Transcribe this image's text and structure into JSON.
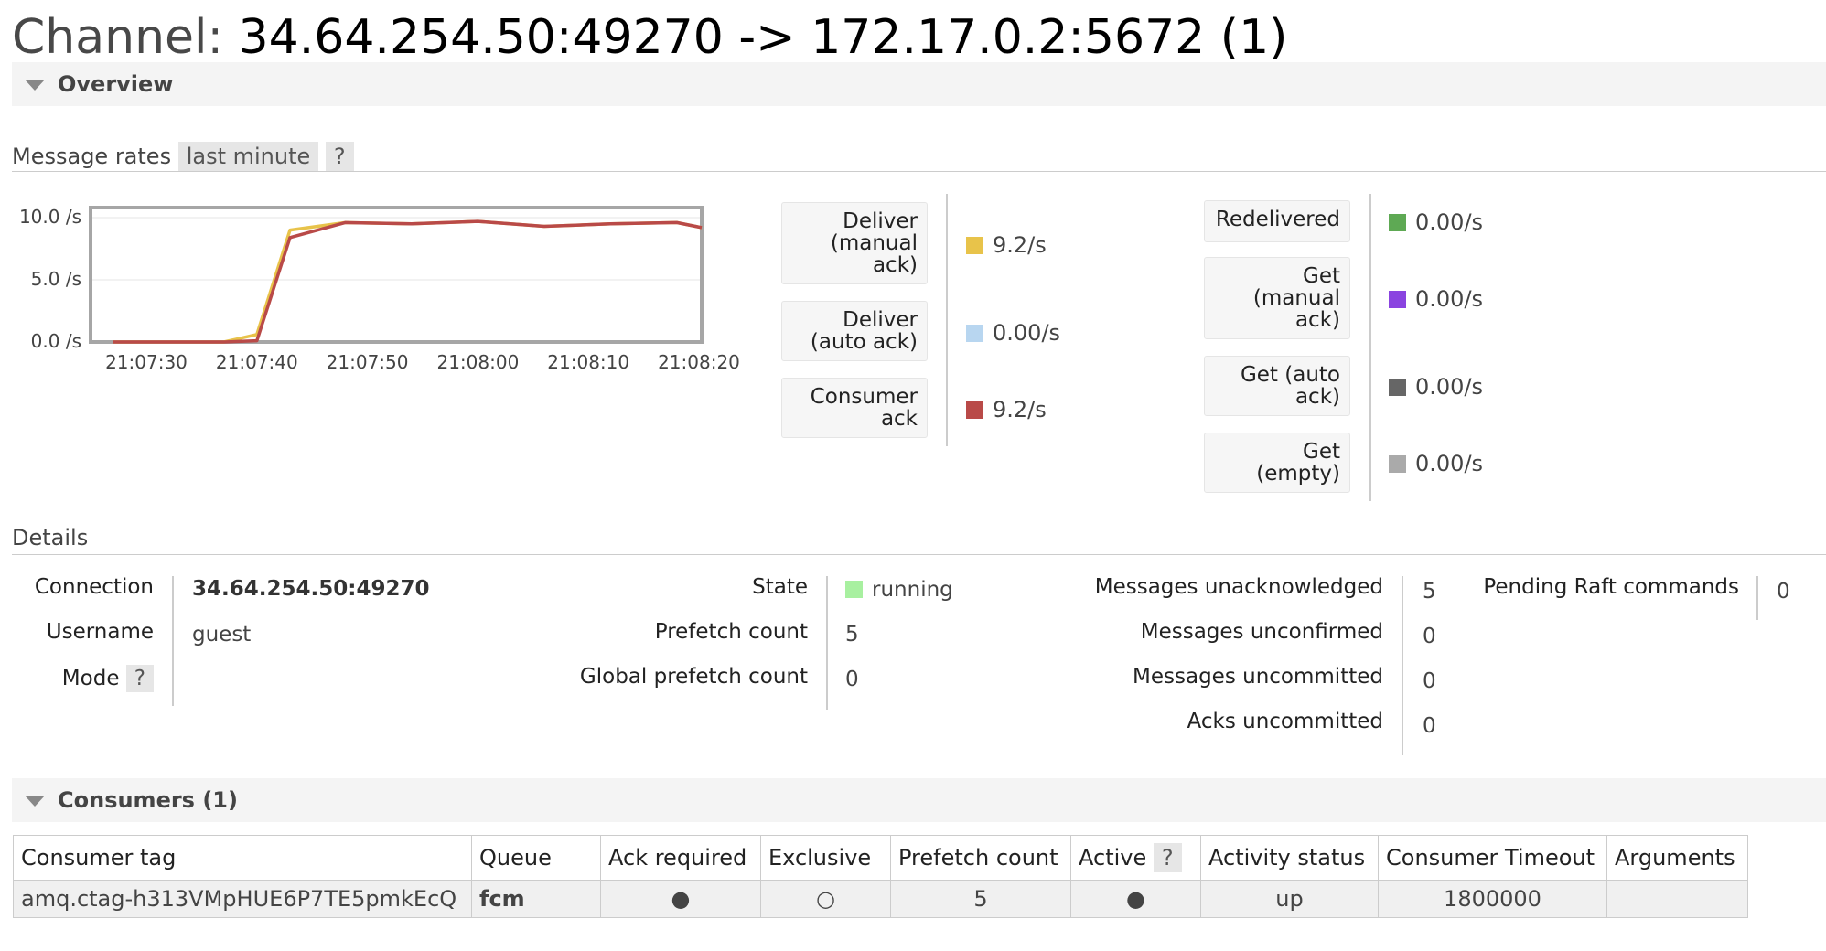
{
  "title": {
    "label": "Channel:",
    "value": "34.64.254.50:49270 -> 172.17.0.2:5672 (1)"
  },
  "overview": {
    "label": "Overview"
  },
  "message_rates": {
    "label": "Message rates",
    "range": "last minute",
    "help": "?"
  },
  "chart_data": {
    "type": "line",
    "x": [
      "21:07:27",
      "21:07:32",
      "21:07:37",
      "21:07:40",
      "21:07:43",
      "21:07:48",
      "21:07:54",
      "21:08:00",
      "21:08:06",
      "21:08:12",
      "21:08:18",
      "21:08:22"
    ],
    "x_ticks": [
      "21:07:30",
      "21:07:40",
      "21:07:50",
      "21:08:00",
      "21:08:10",
      "21:08:20"
    ],
    "y_ticks": [
      "10.0 /s",
      "5.0 /s",
      "0.0 /s"
    ],
    "ylim": [
      0,
      10
    ],
    "series": [
      {
        "name": "Deliver (manual ack)",
        "color": "#e8c34a",
        "values": [
          0,
          0,
          0,
          0.6,
          9.0,
          9.6,
          9.5,
          9.7,
          9.3,
          9.5,
          9.6,
          9.2
        ]
      },
      {
        "name": "Consumer ack",
        "color": "#b94a48",
        "values": [
          0,
          0,
          0,
          0.1,
          8.4,
          9.6,
          9.5,
          9.7,
          9.3,
          9.5,
          9.6,
          9.2
        ]
      }
    ]
  },
  "legend_left": [
    {
      "label": "Deliver (manual ack)",
      "value": "9.2/s",
      "color": "#e8c34a"
    },
    {
      "label": "Deliver (auto ack)",
      "value": "0.00/s",
      "color": "#b8d6f0"
    },
    {
      "label": "Consumer ack",
      "value": "9.2/s",
      "color": "#b94a48"
    }
  ],
  "legend_right": [
    {
      "label": "Redelivered",
      "value": "0.00/s",
      "color": "#5ea954"
    },
    {
      "label": "Get (manual ack)",
      "value": "0.00/s",
      "color": "#8a44e0"
    },
    {
      "label": "Get (auto ack)",
      "value": "0.00/s",
      "color": "#666666"
    },
    {
      "label": "Get (empty)",
      "value": "0.00/s",
      "color": "#aaaaaa"
    }
  ],
  "details": {
    "label": "Details",
    "connection_label": "Connection",
    "connection_value": "34.64.254.50:49270",
    "username_label": "Username",
    "username_value": "guest",
    "mode_label": "Mode",
    "mode_help": "?",
    "state_label": "State",
    "state_value": "running",
    "state_color": "#a8f0a0",
    "prefetch_label": "Prefetch count",
    "prefetch_value": "5",
    "global_prefetch_label": "Global prefetch count",
    "global_prefetch_value": "0",
    "unacked_label": "Messages unacknowledged",
    "unacked_value": "5",
    "unconfirmed_label": "Messages unconfirmed",
    "unconfirmed_value": "0",
    "uncommitted_label": "Messages uncommitted",
    "uncommitted_value": "0",
    "acks_uncommitted_label": "Acks uncommitted",
    "acks_uncommitted_value": "0",
    "raft_label": "Pending Raft commands",
    "raft_value": "0"
  },
  "consumers": {
    "label": "Consumers (1)",
    "columns": [
      "Consumer tag",
      "Queue",
      "Ack required",
      "Exclusive",
      "Prefetch count",
      "Active",
      "Activity status",
      "Consumer Timeout",
      "Arguments"
    ],
    "active_help": "?",
    "rows": [
      {
        "tag": "amq.ctag-h313VMpHUE6P7TE5pmkEcQ",
        "queue": "fcm",
        "ack_required": "●",
        "exclusive": "○",
        "prefetch": "5",
        "active": "●",
        "activity_status": "up",
        "timeout": "1800000",
        "arguments": ""
      }
    ]
  }
}
